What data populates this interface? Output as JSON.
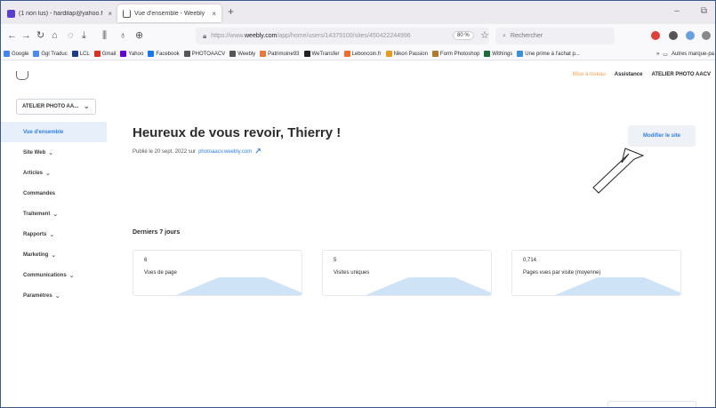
{
  "browser": {
    "tabs": [
      {
        "title": "(1 non lus) - hardilap@yahoo.f",
        "active": false
      },
      {
        "title": "Vue d'ensemble - Weebly",
        "active": true
      }
    ],
    "new_tab": "+",
    "window_controls": {
      "minimize": "–",
      "restore": "⧉"
    },
    "nav": {
      "back": "←",
      "forward": "→",
      "reload": "↻",
      "home": "⌂"
    },
    "url": {
      "prefix": "https://www.",
      "host": "weebly.com",
      "path": "/app/home/users/14379100/sites/450422244996"
    },
    "zoom": "80 %",
    "search_placeholder": "Rechercher",
    "bookmarks": [
      {
        "label": "Google",
        "color": "#4285f4"
      },
      {
        "label": "Ggl Traduc",
        "color": "#4a8af4"
      },
      {
        "label": "LCL",
        "color": "#1a3e8c"
      },
      {
        "label": "Gmail",
        "color": "#d93025"
      },
      {
        "label": "Yahoo",
        "color": "#6001d2"
      },
      {
        "label": "Facebook",
        "color": "#1877f2"
      },
      {
        "label": "PHOTOAACV",
        "color": "#555555"
      },
      {
        "label": "Weebly",
        "color": "#555555"
      },
      {
        "label": "Patrimoine93",
        "color": "#e8793a"
      },
      {
        "label": "WeTransfer",
        "color": "#222222"
      },
      {
        "label": "Leboncoin.fr",
        "color": "#f56b2a"
      },
      {
        "label": "Nikon Passion",
        "color": "#e89b1a"
      },
      {
        "label": "Form Photoshop",
        "color": "#b07a2a"
      },
      {
        "label": "Withings",
        "color": "#1f6b3a"
      },
      {
        "label": "Une prime à l'achat p...",
        "color": "#3a8fd6"
      }
    ],
    "bookmarks_overflow": "»",
    "other_bookmarks": "Autres marque-pa"
  },
  "topbar": {
    "mise_a_niveau": "Mise à niveau",
    "assistance": "Assistance",
    "site_name": "ATELIER PHOTO AACV"
  },
  "sidebar": {
    "site_selector": "ATELIER PHOTO AA...",
    "items": [
      {
        "label": "Vue d'ensemble",
        "active": true,
        "dropdown": false
      },
      {
        "label": "Site Web",
        "active": false,
        "dropdown": true
      },
      {
        "label": "Articles",
        "active": false,
        "dropdown": true
      },
      {
        "label": "Commandes",
        "active": false,
        "dropdown": false
      },
      {
        "label": "Traitement",
        "active": false,
        "dropdown": true
      },
      {
        "label": "Rapports",
        "active": false,
        "dropdown": true
      },
      {
        "label": "Marketing",
        "active": false,
        "dropdown": true
      },
      {
        "label": "Communications",
        "active": false,
        "dropdown": true
      },
      {
        "label": "Paramètres",
        "active": false,
        "dropdown": true
      }
    ]
  },
  "main": {
    "greeting": "Heureux de vous revoir, Thierry !",
    "published_prefix": "Publié le 20 sept. 2022 sur",
    "published_link": "photoaacv.weebly.com",
    "edit_button": "Modifier le site",
    "period_title": "Derniers 7 jours",
    "stats": [
      {
        "value": "6",
        "label": "Vues de page"
      },
      {
        "value": "5",
        "label": "Visites uniques"
      },
      {
        "value": "0,714",
        "label": "Pages vues par visite (moyenne)"
      }
    ]
  },
  "colors": {
    "accent": "#2f7fe6",
    "active_bg": "#e6effa",
    "upgrade": "#f4a14a",
    "sparkline": "#cfe3f7"
  }
}
